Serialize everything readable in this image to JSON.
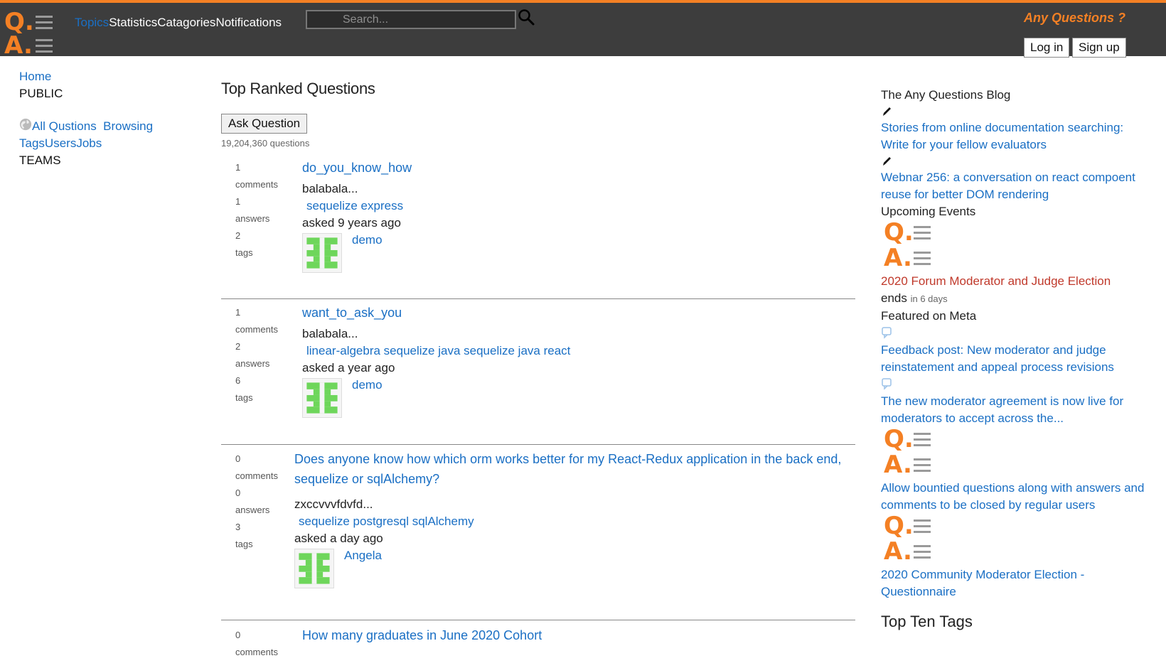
{
  "header": {
    "logo": {
      "q": "Q.",
      "a": "A."
    },
    "nav": [
      "Topics",
      "Statistics",
      "Catagories",
      "Notifications"
    ],
    "search_placeholder": "Search...",
    "brand_tagline": "Any Questions ?",
    "login_label": "Log in",
    "signup_label": "Sign up",
    "accent_color": "#f48024"
  },
  "leftnav": {
    "home": "Home",
    "public": "PUBLIC",
    "all_questions": "All Qustions",
    "browsing": "Browsing",
    "tags": "Tags",
    "users": "Users",
    "jobs": "Jobs",
    "teams": "TEAMS"
  },
  "main": {
    "title": "Top Ranked Questions",
    "ask_button": "Ask Question",
    "question_count": "19,204,360 questions",
    "questions": [
      {
        "comments": "1",
        "answers": "1",
        "tags_count": "2",
        "title": "do_you_know_how",
        "excerpt": "balabala...",
        "tags": "sequelize express",
        "asked": "asked 9 years ago",
        "user": "demo"
      },
      {
        "comments": "1",
        "answers": "2",
        "tags_count": "6",
        "title": "want_to_ask_you",
        "excerpt": "balabala...",
        "tags": "linear-algebra sequelize java sequelize java react",
        "asked": "asked a year ago",
        "user": "demo"
      },
      {
        "comments": "0",
        "answers": "0",
        "tags_count": "3",
        "title": "Does anyone know how which orm works better for my React-Redux application in the back end, sequelize or sqlAlchemy?",
        "excerpt": "zxccvvvfdvfd...",
        "tags": "sequelize postgresql sqlAlchemy",
        "asked": "asked a day ago",
        "user": "Angela"
      },
      {
        "comments": "0",
        "title": "How many graduates in June 2020 Cohort"
      }
    ],
    "labels": {
      "comments": "comments",
      "answers": "answers",
      "tags": "tags"
    }
  },
  "right": {
    "blog_heading": "The Any Questions Blog",
    "blog_post_1": "Stories from online documentation searching: Write for your fellow evaluators",
    "blog_post_2": "Webnar 256: a conversation on react compoent reuse for better DOM rendering",
    "events_heading": "Upcoming Events",
    "event_1": "2020 Forum Moderator and Judge Election",
    "event_ends": "ends",
    "event_ends_in": "in 6 days",
    "meta_heading": "Featured on Meta",
    "meta_1": "Feedback post: New moderator and judge reinstatement and appeal process revisions",
    "meta_2": "The new moderator agreement is now live for moderators to accept across the...",
    "meta_3": "Allow bountied questions along with answers and comments to be closed by regular users",
    "meta_4": "2020 Community Moderator Election - Questionnaire",
    "top_tags_heading": "Top Ten Tags"
  }
}
